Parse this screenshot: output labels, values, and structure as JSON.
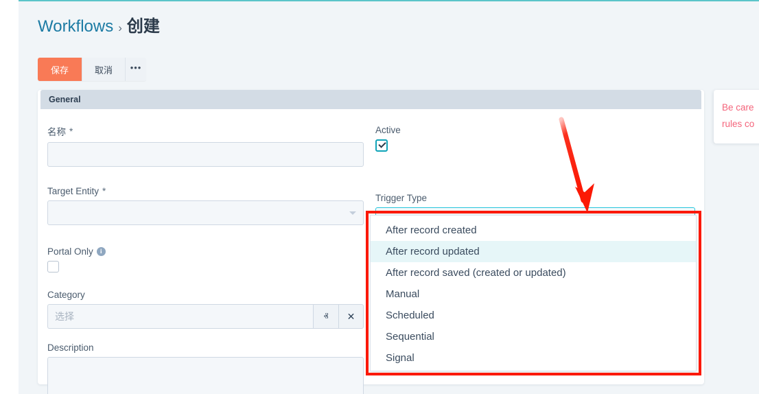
{
  "breadcrumb": {
    "root": "Workflows",
    "separator": "›",
    "current": "创建"
  },
  "toolbar": {
    "save_label": "保存",
    "cancel_label": "取消",
    "more_label": "•••"
  },
  "panel": {
    "header_title": "General"
  },
  "fields": {
    "name": {
      "label": "名称",
      "required_mark": "*",
      "value": ""
    },
    "target_entity": {
      "label": "Target Entity",
      "required_mark": "*",
      "value": ""
    },
    "portal_only": {
      "label": "Portal Only",
      "info_glyph": "i",
      "checked": false
    },
    "category": {
      "label": "Category",
      "placeholder": "选择",
      "value": "",
      "collapse_glyph": "ⱏ",
      "clear_glyph": "✕"
    },
    "description": {
      "label": "Description",
      "value": ""
    },
    "active": {
      "label": "Active",
      "checked": true
    },
    "trigger_type": {
      "label": "Trigger Type",
      "value": "After record created"
    }
  },
  "dropdown": {
    "open": true,
    "highlighted_index": 1,
    "options": [
      "After record created",
      "After record updated",
      "After record saved (created or updated)",
      "Manual",
      "Scheduled",
      "Sequential",
      "Signal"
    ]
  },
  "toast": {
    "line1": "Be care",
    "line2": "rules co"
  },
  "colors": {
    "accent_save": "#f97a56",
    "brand_link": "#1c7ba4",
    "focus_border": "#24c6dd",
    "checkbox_on": "#0fa3b8",
    "annotation_red": "#fb1905",
    "panel_header": "#d3dce5",
    "page_bg": "#f1f5f8",
    "toast_text": "#f4647b",
    "top_rule": "#5bc4c9"
  }
}
